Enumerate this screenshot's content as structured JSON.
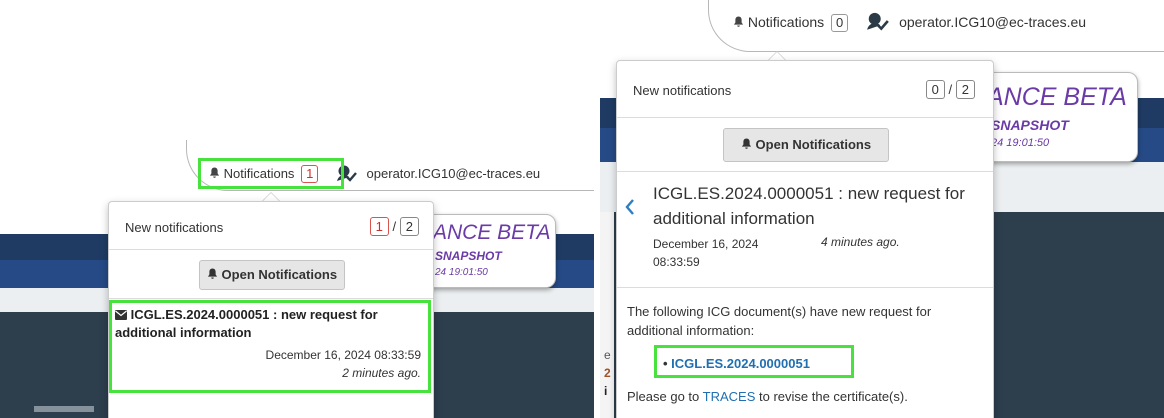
{
  "left": {
    "notifications_label": "Notifications",
    "notifications_count": "1",
    "user": "operator.ICG10@ec-traces.eu",
    "beta_title": "ANCE BETA",
    "beta_subtitle": "SNAPSHOT",
    "beta_date": "24 19:01:50",
    "dropdown": {
      "header": "New notifications",
      "unread": "1",
      "separator": "/",
      "total": "2",
      "open_button": "Open Notifications",
      "item_title": "ICGL.ES.2024.0000051 : new request for additional information",
      "item_date": "December 16, 2024 08:33:59",
      "item_ago": "2 minutes ago."
    }
  },
  "right": {
    "notifications_label": "Notifications",
    "notifications_count": "0",
    "user": "operator.ICG10@ec-traces.eu",
    "beta_title": "ANCE BETA",
    "beta_subtitle": "SNAPSHOT",
    "beta_date": "24 19:01:50",
    "dropdown": {
      "header": "New notifications",
      "unread": "0",
      "separator": "/",
      "total": "2",
      "open_button": "Open Notifications",
      "detail_title": "ICGL.ES.2024.0000051 : new request for additional information",
      "detail_date": "December 16, 2024 08:33:59",
      "detail_ago": "4 minutes ago.",
      "body_text": "The following ICG document(s) have new request for additional information:",
      "document_link": "ICGL.ES.2024.0000051",
      "footer_prefix": "Please go to ",
      "footer_link": "TRACES",
      "footer_suffix": " to revise the certificate(s)."
    },
    "side_chars": [
      "e",
      "2",
      "i"
    ]
  },
  "colors": {
    "highlight": "#48e23f",
    "link": "#1f6fb2",
    "beta_purple": "#6a3aa6",
    "navy": "#1f3b63"
  },
  "icons": [
    "bell-icon",
    "user-check-icon",
    "envelope-icon",
    "chevron-left-icon"
  ]
}
